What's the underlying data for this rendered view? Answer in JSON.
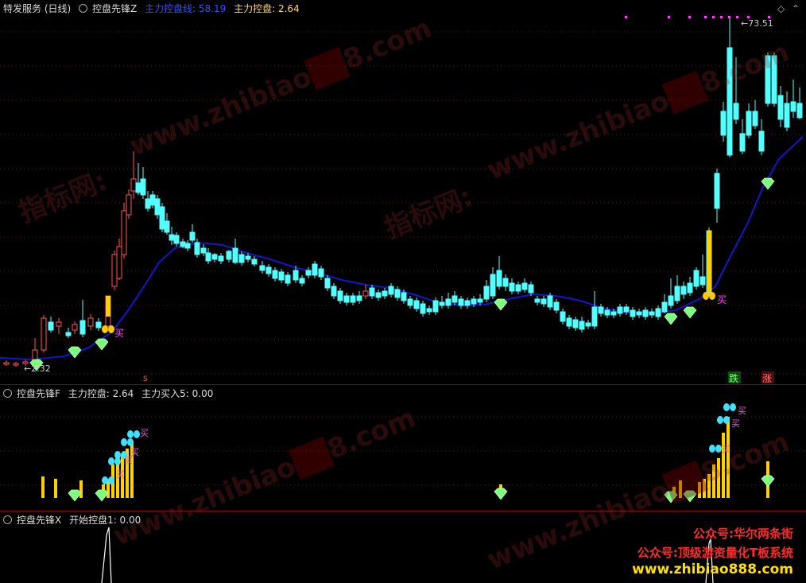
{
  "panel_main": {
    "title": "特发服务 (日线)",
    "indicator": "控盘先锋Z",
    "line_label": "主力控盘线: 58.19",
    "kp_label": "主力控盘: 2.64",
    "high_label": "73.51",
    "low_label": "2.32",
    "s_marker": "S",
    "buy_label": "买",
    "die_label": "跌",
    "zhang_label": "涨"
  },
  "panel_f": {
    "name": "控盘先锋F",
    "kp_label": "主力控盘: 2.64",
    "buy5_label": "主力买入5: 0.00",
    "buy_label": "买"
  },
  "panel_x": {
    "name": "控盘先锋X",
    "start_label": "开始控盘1: 0.00"
  },
  "watermark": {
    "site_a": "www.zhibiao",
    "site_b": "8.com",
    "brand": "指标网:"
  },
  "promo": {
    "line1": "公众号:华尔两条街",
    "line2": "公众号:顶级游资量化T板系统",
    "line3": "www.zhibiao888.com"
  },
  "colors": {
    "up": "#ff5555",
    "down": "#54ffff",
    "line": "#1515cc",
    "bar": "#ffd000",
    "diamond": "#7dff7d",
    "magenta": "#ff44ff"
  }
}
